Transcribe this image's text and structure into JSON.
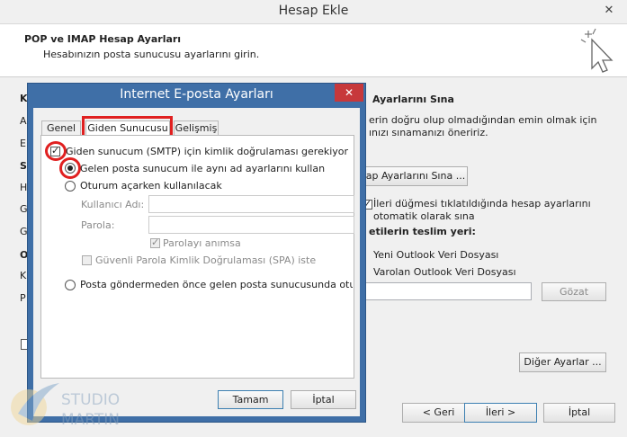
{
  "window": {
    "title": "Hesap Ekle",
    "close_glyph": "✕",
    "header_title": "POP ve IMAP Hesap Ayarları",
    "header_subtitle": "Hesabınızın posta sunucusu ayarlarını girin."
  },
  "background": {
    "left_letters": [
      "K",
      "A",
      "E",
      "S",
      "H",
      "G",
      "G",
      "O",
      "K",
      "P"
    ],
    "test_heading": "Ayarlarını Sına",
    "test_desc_line1": "erin doğru olup olmadığından emin olmak için",
    "test_desc_line2": "ınızı sınamanızı öneririz.",
    "test_button": "ap Ayarlarını Sına ...",
    "auto_test_line1": "İleri düğmesi tıklatıldığında hesap ayarlarını",
    "auto_test_line2": "otomatik olarak sına",
    "delivery_heading": "etilerin teslim yeri:",
    "new_pst": "Yeni Outlook Veri Dosyası",
    "existing_pst": "Varolan Outlook Veri Dosyası",
    "browse_button": "Gözat",
    "more_settings_button": "Diğer Ayarlar ...",
    "back_button": "< Geri",
    "next_button": "İleri >",
    "cancel_button": "İptal"
  },
  "dialog": {
    "title": "Internet E-posta Ayarları",
    "close_glyph": "✕",
    "tabs": [
      {
        "label": "Genel"
      },
      {
        "label": "Giden Sunucusu"
      },
      {
        "label": "Gelişmiş"
      }
    ],
    "smtp_auth_label": "Giden sunucum (SMTP) için kimlik doğrulaması gerekiyor",
    "same_settings_label": "Gelen posta sunucum ile aynı ad ayarlarını kullan",
    "logon_label": "Oturum açarken kullanılacak",
    "username_label": "Kullanıcı Adı:",
    "password_label": "Parola:",
    "username_value": "",
    "password_value": "",
    "remember_pw_label": "Parolayı anımsa",
    "spa_label": "Güvenli Parola Kimlik Doğrulaması (SPA) iste",
    "logon_before_label": "Posta göndermeden önce gelen posta sunucusunda oturum",
    "ok_button": "Tamam",
    "cancel_button": "İptal"
  },
  "watermark": {
    "line1": "STUDIO",
    "line2": "MARTIN"
  },
  "colors": {
    "dialog_frame": "#3f6fa7",
    "close_red": "#c7383b",
    "highlight_red": "#e02020"
  }
}
